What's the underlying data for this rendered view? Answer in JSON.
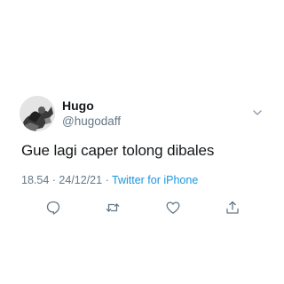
{
  "tweet": {
    "author": {
      "display_name": "Hugo",
      "handle": "@hugodaff",
      "avatar_icon": "profile-photo"
    },
    "text": "Gue lagi caper tolong dibales",
    "time": "18.54",
    "separator": "·",
    "date": "24/12/21",
    "source": "Twitter for iPhone"
  },
  "actions": [
    {
      "name": "reply",
      "icon": "speech-bubble-icon"
    },
    {
      "name": "retweet",
      "icon": "retweet-arrows-icon"
    },
    {
      "name": "like",
      "icon": "heart-icon"
    },
    {
      "name": "share",
      "icon": "share-upload-icon"
    }
  ],
  "colors": {
    "text": "#14171a",
    "secondary": "#657786",
    "link": "#1b95e0",
    "icon": "#657786"
  }
}
